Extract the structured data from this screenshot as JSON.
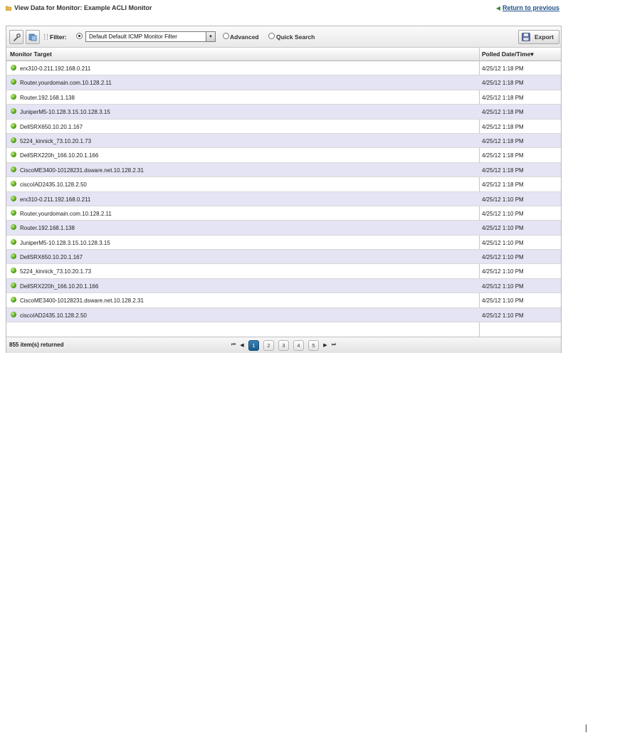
{
  "header": {
    "title": "View Data for Monitor: Example ACLI Monitor",
    "return_label": "Return to previous"
  },
  "toolbar": {
    "icons": [
      "wrench-icon",
      "refresh-icon"
    ],
    "filter_label": "Filter:",
    "filter_value": "Default Default ICMP Monitor Filter",
    "advanced_label": "Advanced",
    "quick_search_label": "Quick Search",
    "export_label": "Export"
  },
  "table": {
    "columns": [
      "Monitor Target",
      "Polled Date/Time"
    ],
    "sort_indicator": "▾",
    "rows": [
      {
        "target": "erx310-0.211.192.168.0.211",
        "date": "4/25/12 1:18 PM"
      },
      {
        "target": "Router.yourdomain.com.10.128.2.11",
        "date": "4/25/12 1:18 PM"
      },
      {
        "target": "Router.192.168.1.138",
        "date": "4/25/12 1:18 PM"
      },
      {
        "target": "JuniperM5-10.128.3.15.10.128.3.15",
        "date": "4/25/12 1:18 PM"
      },
      {
        "target": "DellSRX650.10.20.1.167",
        "date": "4/25/12 1:18 PM"
      },
      {
        "target": "5224_kinnick_73.10.20.1.73",
        "date": "4/25/12 1:18 PM"
      },
      {
        "target": "DellSRX220h_166.10.20.1.166",
        "date": "4/25/12 1:18 PM"
      },
      {
        "target": "CiscoME3400-10128231.dsware.net.10.128.2.31",
        "date": "4/25/12 1:18 PM"
      },
      {
        "target": "ciscoIAD2435.10.128.2.50",
        "date": "4/25/12 1:18 PM"
      },
      {
        "target": "erx310-0.211.192.168.0.211",
        "date": "4/25/12 1:10 PM"
      },
      {
        "target": "Router.yourdomain.com.10.128.2.11",
        "date": "4/25/12 1:10 PM"
      },
      {
        "target": "Router.192.168.1.138",
        "date": "4/25/12 1:10 PM"
      },
      {
        "target": "JuniperM5-10.128.3.15.10.128.3.15",
        "date": "4/25/12 1:10 PM"
      },
      {
        "target": "DellSRX650.10.20.1.167",
        "date": "4/25/12 1:10 PM"
      },
      {
        "target": "5224_kinnick_73.10.20.1.73",
        "date": "4/25/12 1:10 PM"
      },
      {
        "target": "DellSRX220h_166.10.20.1.166",
        "date": "4/25/12 1:10 PM"
      },
      {
        "target": "CiscoME3400-10128231.dsware.net.10.128.2.31",
        "date": "4/25/12 1:10 PM"
      },
      {
        "target": "ciscoIAD2435.10.128.2.50",
        "date": "4/25/12 1:10 PM"
      }
    ]
  },
  "footer": {
    "count_text": "855 item(s) returned",
    "pages": [
      "1",
      "2",
      "3",
      "4",
      "5"
    ],
    "current_page": "1",
    "nav": {
      "first": "⏮",
      "prev": "◀",
      "next": "▶",
      "last": "⏭"
    }
  },
  "colors": {
    "row_alt": "#e4e4f4",
    "status_ok": "#4ea21c",
    "link": "#1e4f8a",
    "active_page": "#1b5a8c"
  }
}
